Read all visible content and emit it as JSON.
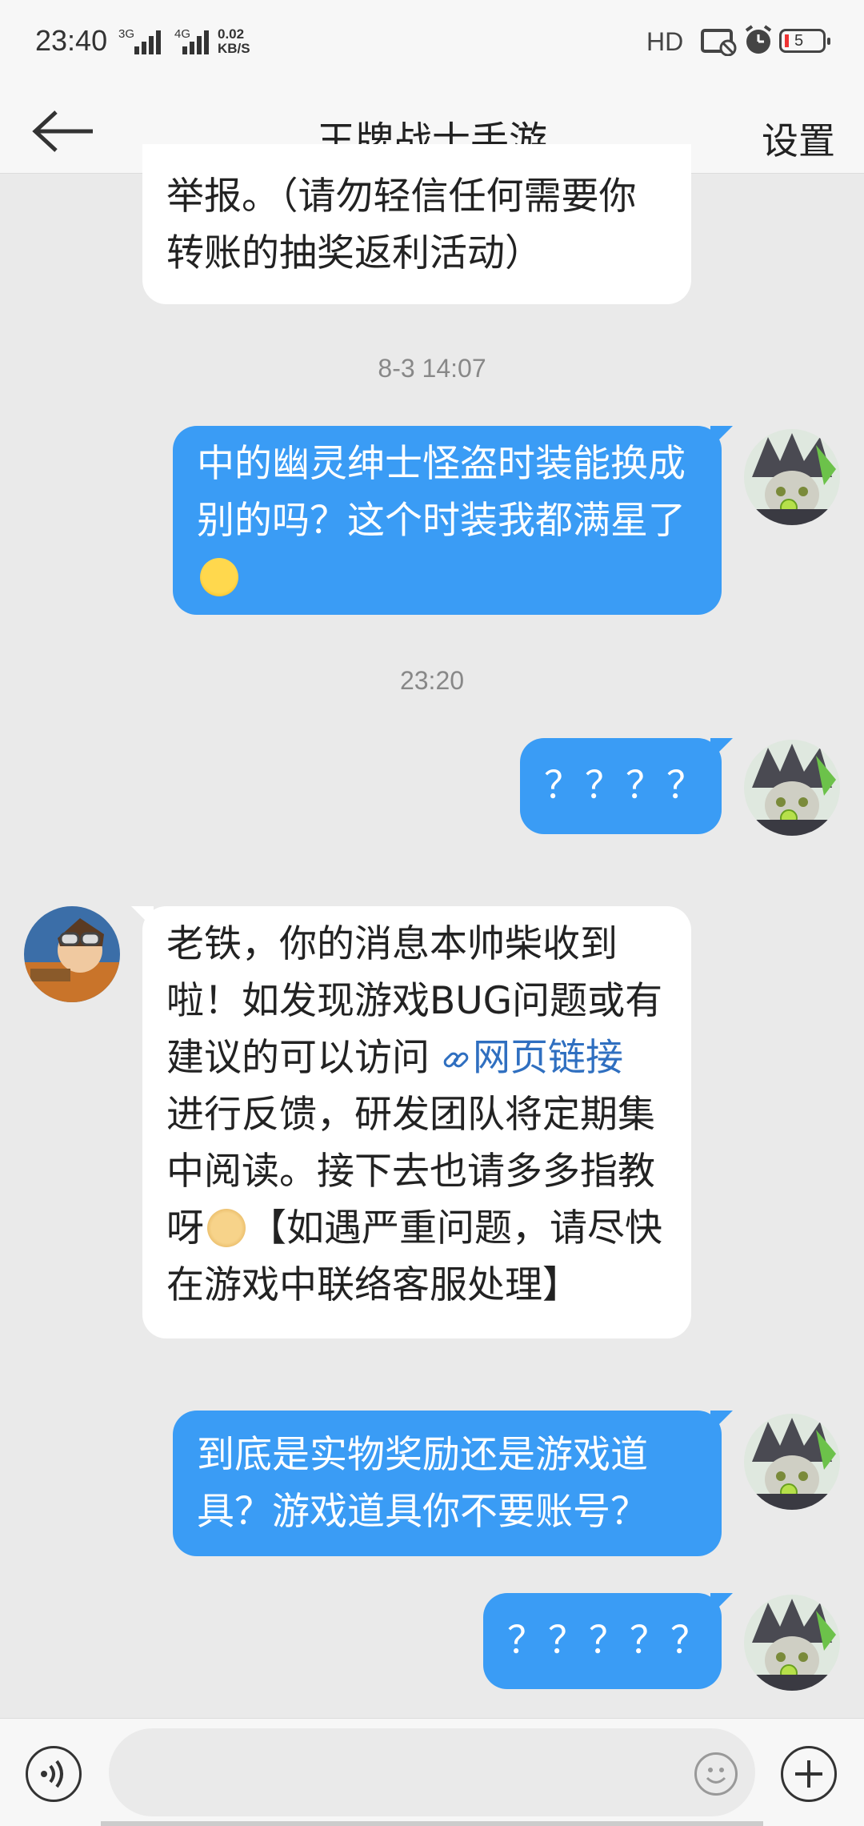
{
  "status_bar": {
    "time": "23:40",
    "net1": "3G",
    "net2": "4G",
    "speed_value": "0.02",
    "speed_unit": "KB/S",
    "hd": "HD",
    "battery": "5"
  },
  "header": {
    "title": "王牌战士手游",
    "settings_label": "设置"
  },
  "messages": [
    {
      "direction": "in",
      "text": "举报。（请勿轻信任何需要你转账的抽奖返利活动）"
    },
    {
      "timestamp": "8-3 14:07"
    },
    {
      "direction": "out",
      "text": "中的幽灵绅士怪盗时装能换成别的吗？这个时装我都满星了"
    },
    {
      "timestamp": "23:20"
    },
    {
      "direction": "out",
      "text": "？？？？"
    },
    {
      "direction": "in",
      "text_before": "老铁，你的消息本帅柴收到啦！如发现游戏BUG问题或有建议的可以访问",
      "link": "网页链接",
      "text_mid": "进行反馈，研发团队将定期集中阅读。接下去也请多多指教呀",
      "text_after": "【如遇严重问题，请尽快在游戏中联络客服处理】"
    },
    {
      "direction": "out",
      "text": "到底是实物奖励还是游戏道具？游戏道具你不要账号？"
    },
    {
      "direction": "out",
      "text": "？？？？？"
    }
  ],
  "input": {
    "placeholder": ""
  },
  "icons": {
    "back": "arrow-left-icon",
    "voice": "voice-icon",
    "emoji": "smile-icon",
    "plus": "plus-icon"
  },
  "colors": {
    "outgoing_bubble": "#3a9cf5",
    "incoming_bubble": "#ffffff",
    "background": "#eaeaea",
    "link": "#2f6fc0"
  }
}
